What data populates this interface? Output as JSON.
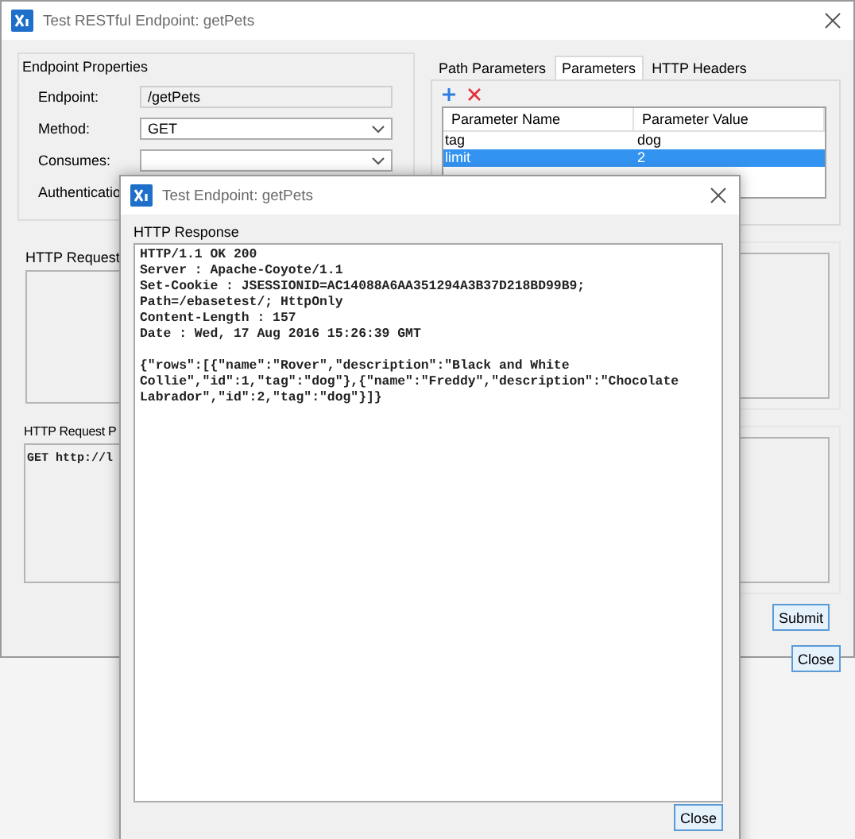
{
  "main_window": {
    "title": "Test RESTful Endpoint: getPets",
    "endpoint_properties": {
      "title": "Endpoint Properties",
      "fields": [
        {
          "label": "Endpoint:",
          "value": "/getPets",
          "kind": "readonly"
        },
        {
          "label": "Method:",
          "value": "GET",
          "kind": "dropdown"
        },
        {
          "label": "Consumes:",
          "kind": "dropdown"
        },
        {
          "label": "Authenticatio",
          "kind": "label"
        }
      ]
    },
    "http_request": {
      "title": "HTTP Request"
    },
    "http_request_preview": {
      "title": "HTTP Request P",
      "text": "GET http://l"
    },
    "tabs": [
      {
        "label": "Path Parameters",
        "selected": false
      },
      {
        "label": "Parameters",
        "selected": true
      },
      {
        "label": "HTTP Headers",
        "selected": false
      }
    ],
    "parameters": {
      "columns": [
        "Parameter Name",
        "Parameter Value"
      ],
      "rows": [
        {
          "cells": [
            "tag",
            "dog"
          ],
          "selected": false
        },
        {
          "cells": [
            "limit",
            "2"
          ],
          "selected": true
        }
      ]
    },
    "buttons": [
      "Submit",
      "Close"
    ]
  },
  "dialog": {
    "title": "Test Endpoint: getPets",
    "response_label": "HTTP Response",
    "headers": "HTTP/1.1 OK 200\nServer : Apache-Coyote/1.1\nSet-Cookie : JSESSIONID=AC14088A6AA351294A3B37D218BD99B9;\nPath=/ebasetest/; HttpOnly\nContent-Length : 157\nDate : Wed, 17 Aug 2016 15:26:39 GMT",
    "body": "{\"rows\":[{\"name\":\"Rover\",\"description\":\"Black and White\nCollie\",\"id\":1,\"tag\":\"dog\"},{\"name\":\"Freddy\",\"description\":\"Chocolate\nLabrador\",\"id\":2,\"tag\":\"dog\"}]}",
    "button": "Close"
  }
}
